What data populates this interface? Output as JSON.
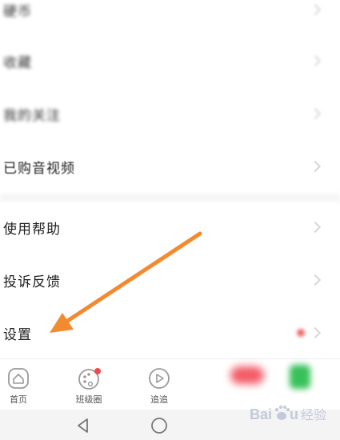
{
  "menu": {
    "items": [
      {
        "label": "硬币",
        "blurred": true
      },
      {
        "label": "收藏",
        "blurred": true
      },
      {
        "label": "我的关注",
        "blurred": true
      },
      {
        "label": "已购音视频",
        "blurred": false
      },
      {
        "label": "使用帮助",
        "blurred": false
      },
      {
        "label": "投诉反馈",
        "blurred": false
      },
      {
        "label": "设置",
        "blurred": false
      }
    ]
  },
  "bottom_nav": {
    "items": [
      {
        "label": "首页",
        "icon": "home-icon"
      },
      {
        "label": "班级圈",
        "icon": "palette-icon",
        "badge": true
      },
      {
        "label": "追追",
        "icon": "play-icon"
      }
    ]
  },
  "annotation": {
    "arrow_color": "#f28a30",
    "points_to": "设置"
  },
  "watermark": {
    "text": "Baidu 经验"
  },
  "colors": {
    "badge": "#f04a4a",
    "red_pill": "#f45b66",
    "green_block": "#37c15a"
  }
}
